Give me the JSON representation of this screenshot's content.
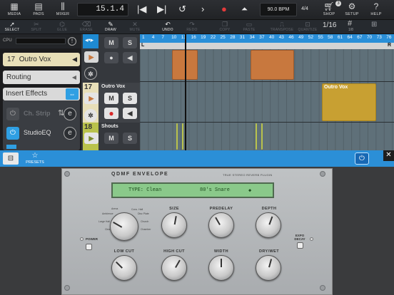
{
  "topbar": {
    "media": "MEDIA",
    "pads": "PADS",
    "mixer": "MIXER",
    "position": "15.1.4",
    "tempo": "90.0 BPM",
    "signature": "4/4",
    "shop": "SHOP",
    "shop_badge": "3",
    "setup": "SETUP",
    "help": "HELP"
  },
  "tools": {
    "select": "SELECT",
    "split": "SPLIT",
    "glue": "GLUE",
    "erase": "ERASE",
    "draw": "DRAW",
    "mute": "MUTE",
    "undo": "UNDO",
    "redo": "REDO",
    "copy": "COPY",
    "paste": "PASTE",
    "transpose": "TRANSPOSE",
    "quantize": "QUANTIZE",
    "quant_value": "1/16",
    "quant_sub": "1/8"
  },
  "inspector": {
    "cpu": "CPU",
    "track_number": "17",
    "track_name": "Outro Vox",
    "routing": "Routing",
    "insert_effects": "Insert Effects",
    "inserts": [
      {
        "name": "Ch. Strip",
        "active": false
      },
      {
        "name": "StudioEQ",
        "active": true
      }
    ]
  },
  "tracks": [
    {
      "number": "",
      "name": "",
      "color": "#1e8ad2"
    },
    {
      "number": "17",
      "name": "Outro Vox",
      "color": "#e8dfb8"
    },
    {
      "number": "18",
      "name": "Shouts",
      "color": "#b9c24c"
    }
  ],
  "ruler": {
    "bars": [
      "1",
      "4",
      "7",
      "10",
      "13",
      "16",
      "19",
      "22",
      "25",
      "28",
      "31",
      "34",
      "37",
      "40",
      "43",
      "46",
      "49",
      "52",
      "55",
      "58",
      "61",
      "64",
      "67",
      "70",
      "73",
      "76"
    ],
    "left_marker": "L",
    "right_marker": "R"
  },
  "clips": [
    {
      "name": "Outro Vox",
      "track": "17"
    }
  ],
  "plugin_header": {
    "presets": "PRESETS"
  },
  "plugin": {
    "title": "QDMF ENVELOPE",
    "subtitle": "TRUE STEREO REVERB PLUGIN",
    "lcd_type": "TYPE: Clean",
    "lcd_preset": "80's Snare",
    "knobs": {
      "size": "SIZE",
      "predelay": "PREDELAY",
      "depth": "DEPTH",
      "low_cut": "LOW CUT",
      "high_cut": "HIGH CUT",
      "width": "WIDTH",
      "dry_wet": "DRY/WET"
    },
    "mode_labels": [
      "Arena",
      "Conc. Hall",
      "Ambience",
      "Disc Plate",
      "Large Hall",
      "Church",
      "Clean",
      "Chamber"
    ],
    "power": "POWER",
    "expo_decay": "EXPO DECAY"
  }
}
